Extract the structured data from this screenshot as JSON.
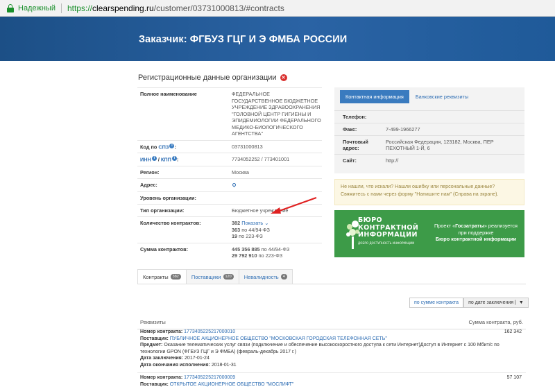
{
  "browser": {
    "secure_label": "Надежный",
    "url_protocol": "https://",
    "url_host": "clearspending.ru",
    "url_path": "/customer/03731000813/#contracts"
  },
  "header": {
    "title": "Заказчик: ФГБУЗ ГЦГ И Э ФМБА РОССИИ"
  },
  "registration": {
    "section_title": "Регистрационные данные организации",
    "rows": {
      "full_name_label": "Полное наименование",
      "full_name_value": "ФЕДЕРАЛЬНОЕ ГОСУДАРСТВЕННОЕ БЮДЖЕТНОЕ УЧРЕЖДЕНИЕ ЗДРАВООХРАНЕНИЯ \"ГОЛОВНОЙ ЦЕНТР ГИГИЕНЫ И ЭПИДЕМИОЛОГИИ ФЕДЕРАЛЬНОГО МЕДИКО-БИОЛОГИЧЕСКОГО АГЕНТСТВА\"",
      "spz_label_prefix": "Код по",
      "spz_link": "СПЗ",
      "spz_value": "03731000813",
      "inn_link": "ИНН",
      "kpp_link": "КПП",
      "inn_value": "7734052252 / 773401001",
      "region_label": "Регион:",
      "region_value": "Москва",
      "address_label": "Адрес:",
      "level_label": "Уровень организации:",
      "type_label": "Тип организации:",
      "type_value": "Бюджетное учреждение",
      "contracts_count_label": "Количество контрактов:",
      "contracts_total": "382",
      "show_link": "Показать",
      "contracts_44_num": "363",
      "contracts_44_text": "по 44/94-ФЗ",
      "contracts_223_num": "19",
      "contracts_223_text": "по 223-ФЗ",
      "contracts_sum_label": "Сумма контрактов:",
      "sum_44_num": "445 356 885",
      "sum_44_text": "по 44/94-ФЗ",
      "sum_223_num": "29 792 910",
      "sum_223_text": "по 223-ФЗ"
    }
  },
  "contact_panel": {
    "tab_contacts": "Контактная информация",
    "tab_bank": "Банковские реквизиты",
    "phone_label": "Телефон:",
    "fax_label": "Факс:",
    "fax_value": "7-499-1966277",
    "postal_label": "Почтовый адрес:",
    "postal_value": "Российская Федерация, 123182, Москва, ПЕР ПЕХОТНЫЙ 1-Й, 6",
    "site_label": "Сайт:",
    "site_value": "http://"
  },
  "notice": {
    "line1": "Не нашли, что искали? Нашли ошибку или персональные данные?",
    "line2": "Свяжитесь с нами через форму \"Напишите нам\" (Справа на экране)."
  },
  "promo": {
    "logo_line1": "БЮРО",
    "logo_line2": "КОНТРАКТНОЙ",
    "logo_line3": "ИНФОРМАЦИИ",
    "logo_small": "ДОБРО ДОСТУПНОСТЬ ИНФОРМАЦИИ",
    "text_prefix": "Проект «",
    "text_brand": "Госзатраты",
    "text_mid": "» реализуется при поддержке",
    "text_bureau": "Бюро контрактной информации"
  },
  "tabs": [
    {
      "label": "Контракты",
      "badge": "382"
    },
    {
      "label": "Поставщики",
      "badge": "120"
    },
    {
      "label": "Невалидность",
      "badge": "4"
    }
  ],
  "sort": {
    "by_sum": "по сумме контракта",
    "by_date": "по дате заключения",
    "separator": "|"
  },
  "contracts_header": {
    "left": "Реквизиты",
    "right": "Сумма контракта, руб."
  },
  "contracts": [
    {
      "number_label": "Номер контракта:",
      "number": "1773405225217000010",
      "supplier_label": "Поставщик:",
      "supplier": "ПУБЛИЧНОЕ АКЦИОНЕРНОЕ ОБЩЕСТВО \"МОСКОВСКАЯ ГОРОДСКАЯ ТЕЛЕФОННАЯ СЕТЬ\"",
      "subject_label": "Предмет:",
      "subject": "Оказание телематических услуг связи (подключение и обеспечение высокоскоростного доступа к сети Интернет)Доступ в Интернет с 100 Мбит/с по технологии GPON (ФГБУЗ ГЦГ и Э ФМБА) (февраль-декабрь 2017 г.)",
      "date_label": "Дата заключения:",
      "date": "2017-01-24",
      "end_label": "Дата окончания исполнения:",
      "end": "2018-01-31",
      "sum": "162 342"
    },
    {
      "number_label": "Номер контракта:",
      "number": "1773405225217000009",
      "supplier_label": "Поставщик:",
      "supplier": "ОТКРЫТОЕ АКЦИОНЕРНОЕ ОБЩЕСТВО \"МОСЛИФТ\"",
      "sum": "57 107"
    }
  ]
}
